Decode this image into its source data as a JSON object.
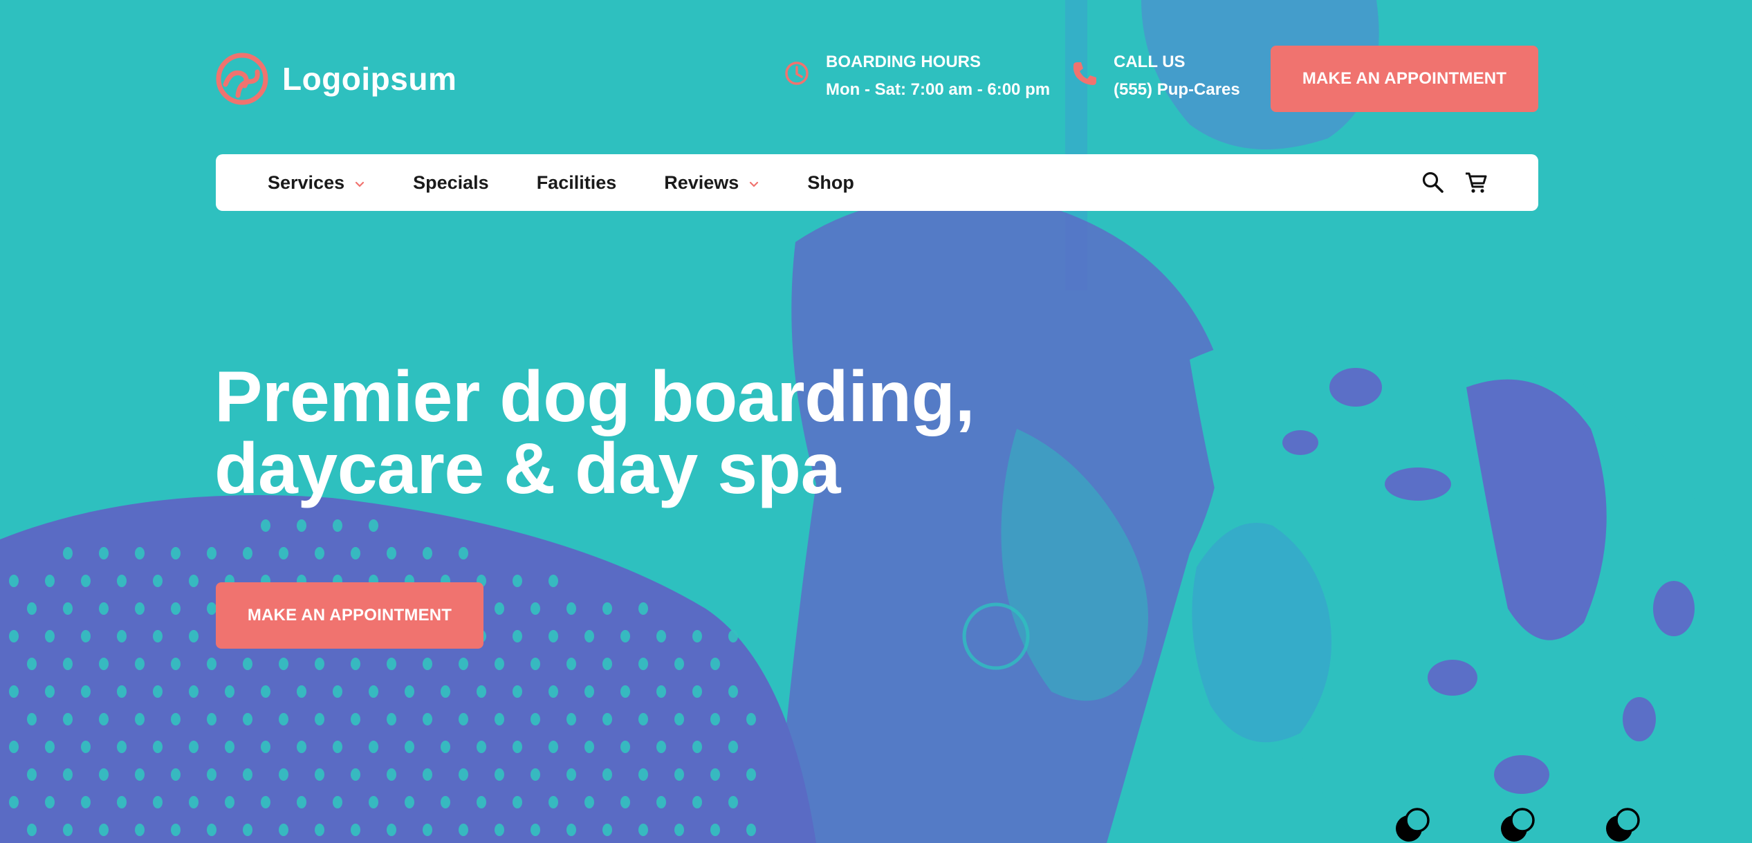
{
  "brand": {
    "name": "Logoipsum",
    "accent_color": "#f0736f",
    "background_color": "#2ec0bf",
    "photo_tint": "#5b6fc7"
  },
  "header": {
    "hours": {
      "icon": "clock-icon",
      "label": "BOARDING HOURS",
      "value": "Mon - Sat: 7:00 am - 6:00 pm"
    },
    "call": {
      "icon": "phone-icon",
      "label": "CALL US",
      "value": "(555) Pup-Cares"
    },
    "cta_label": "MAKE AN APPOINTMENT"
  },
  "nav": {
    "items": [
      {
        "label": "Services",
        "has_dropdown": true
      },
      {
        "label": "Specials",
        "has_dropdown": false
      },
      {
        "label": "Facilities",
        "has_dropdown": false
      },
      {
        "label": "Reviews",
        "has_dropdown": true
      },
      {
        "label": "Shop",
        "has_dropdown": false
      }
    ],
    "icons": [
      "search-icon",
      "cart-icon"
    ]
  },
  "hero": {
    "title_line1": "Premier dog boarding,",
    "title_line2": "daycare & day spa",
    "cta_label": "MAKE AN APPOINTMENT"
  },
  "slider": {
    "dot_count": 3
  }
}
